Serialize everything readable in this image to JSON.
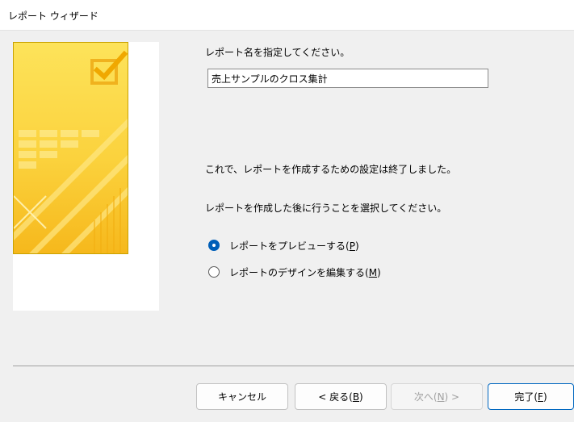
{
  "window": {
    "title": "レポート ウィザード"
  },
  "report_name": {
    "prompt": "レポート名を指定してください。",
    "value": "売上サンプルのクロス集計"
  },
  "info": {
    "done_text": "これで、レポートを作成するための設定は終了しました。",
    "choose_text": "レポートを作成した後に行うことを選択してください。"
  },
  "options": {
    "preview": {
      "label": "レポートをプレビューする(",
      "mnemonic": "P",
      "suffix": ")",
      "checked": true
    },
    "design": {
      "label": "レポートのデザインを編集する(",
      "mnemonic": "M",
      "suffix": ")",
      "checked": false
    }
  },
  "buttons": {
    "cancel": {
      "label": "キャンセル"
    },
    "back": {
      "label": "< 戻る(",
      "mnemonic": "B",
      "suffix": ")"
    },
    "next": {
      "label": "次へ(",
      "mnemonic": "N",
      "suffix": ") >",
      "enabled": false
    },
    "finish": {
      "label": "完了(",
      "mnemonic": "F",
      "suffix": ")"
    }
  },
  "colors": {
    "accent": "#005fb8",
    "illustration": "#fbd23d"
  }
}
